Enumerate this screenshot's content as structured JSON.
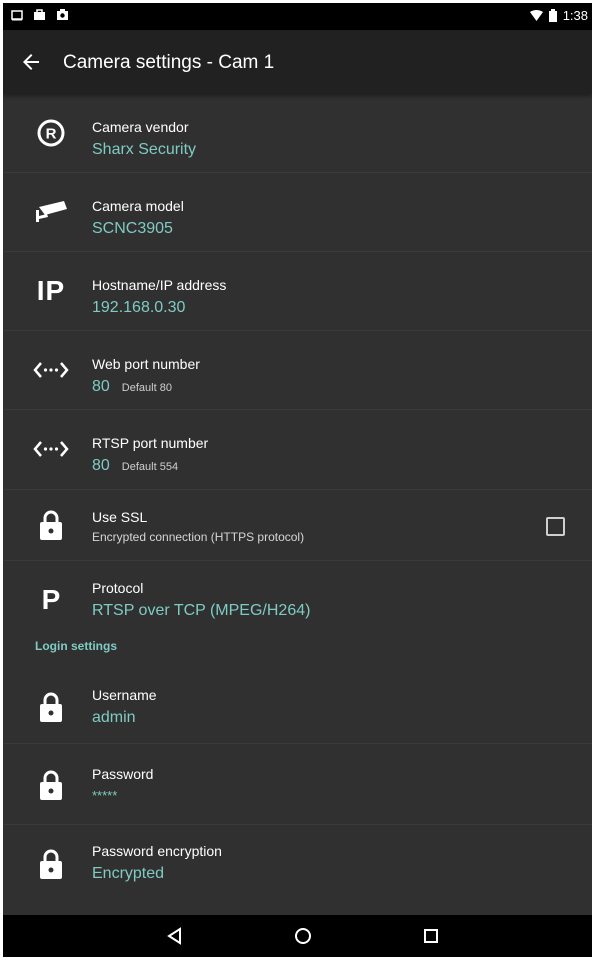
{
  "status_bar": {
    "time": "1:38",
    "icons": [
      "screen-icon",
      "bag-icon",
      "photo-icon",
      "wifi-icon",
      "battery-icon"
    ]
  },
  "app_bar": {
    "title": "Camera settings - Cam 1"
  },
  "settings": {
    "vendor": {
      "label": "Camera vendor",
      "value": "Sharx Security"
    },
    "model": {
      "label": "Camera model",
      "value": "SCNC3905"
    },
    "host": {
      "label": "Hostname/IP address",
      "value": "192.168.0.30",
      "icon_text": "IP"
    },
    "web_port": {
      "label": "Web port number",
      "value": "80",
      "hint": "Default 80"
    },
    "rtsp_port": {
      "label": "RTSP port number",
      "value": "80",
      "hint": "Default 554"
    },
    "ssl": {
      "label": "Use SSL",
      "sub": "Encrypted connection (HTTPS protocol)",
      "checked": false
    },
    "protocol": {
      "label": "Protocol",
      "value": "RTSP over TCP (MPEG/H264)",
      "icon_text": "P"
    }
  },
  "login_section": {
    "header": "Login settings",
    "username": {
      "label": "Username",
      "value": "admin"
    },
    "password": {
      "label": "Password",
      "value": "*****"
    },
    "encryption": {
      "label": "Password encryption",
      "value": "Encrypted"
    }
  },
  "colors": {
    "accent": "#7fcbc4",
    "background": "#303030",
    "appbar": "#212121"
  }
}
